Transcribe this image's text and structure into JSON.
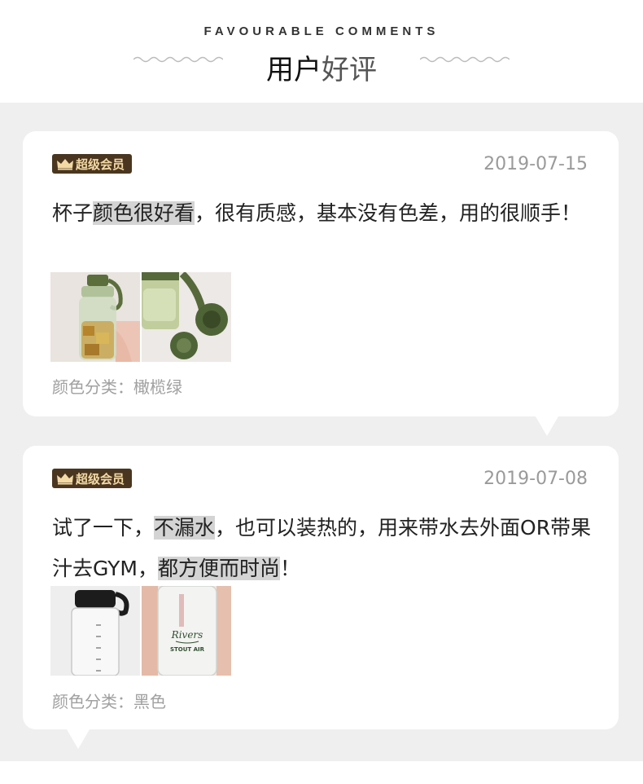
{
  "header": {
    "en_title": "FAVOURABLE COMMENTS",
    "zh_title_main": "用户",
    "zh_title_light": "好评"
  },
  "reviews": [
    {
      "badge": "超级会员",
      "date": "2019-07-15",
      "text_parts": [
        "杯子",
        "颜色很好看",
        "，很有质感，基本没有色差，用的很顺手！"
      ],
      "spec": "颜色分类：橄榄绿",
      "photos": [
        "olive-bottle-photo",
        "olive-lid-photo"
      ]
    },
    {
      "badge": "超级会员",
      "date": "2019-07-08",
      "text_parts": [
        "试了一下，",
        "不漏水",
        "，也可以装热的，用来带水去外面OR带果汁去GYM，",
        "都方便而时尚",
        "！"
      ],
      "spec": "颜色分类：黑色",
      "photos": [
        "black-bottle-photo",
        "clear-bottle-photo"
      ]
    }
  ],
  "colors": {
    "badge_bg": "#4a3620",
    "badge_text": "#f3d9a4",
    "highlight": "#d4d4d4",
    "page_bg": "#efefef"
  }
}
